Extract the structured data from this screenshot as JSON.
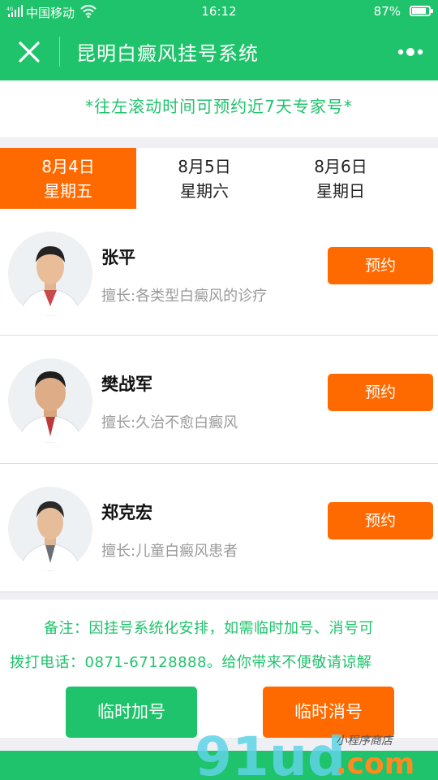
{
  "status_bar": {
    "carrier": "中国移动",
    "time": "16:12",
    "battery": "87%",
    "battery_level": 0.87
  },
  "nav": {
    "title": "昆明白癜风挂号系统",
    "close_icon": "close-icon",
    "more_icon": "more-dots-icon"
  },
  "notice": "*往左滚动时间可预约近7天专家号*",
  "dates": [
    {
      "date": "8月4日",
      "weekday": "星期五",
      "active": true
    },
    {
      "date": "8月5日",
      "weekday": "星期六",
      "active": false
    },
    {
      "date": "8月6日",
      "weekday": "星期日",
      "active": false
    }
  ],
  "doctors": [
    {
      "name": "张平",
      "specialty": "擅长:各类型白癜风的诊疗",
      "button": "预约"
    },
    {
      "name": "樊战军",
      "specialty": "擅长:久治不愈白癜风",
      "button": "预约"
    },
    {
      "name": "郑克宏",
      "specialty": "擅长:儿童白癜风患者",
      "button": "预约"
    }
  ],
  "remark": {
    "line1": "备注：因挂号系统化安排，如需临时加号、消号可",
    "line2": "拨打电话：0871-67128888。给你带来不便敬请谅解"
  },
  "actions": {
    "add": "临时加号",
    "cancel": "临时消号"
  },
  "watermark": {
    "brand": "91ud",
    "domain": ".com",
    "tagline": "小程序商店"
  },
  "colors": {
    "brand_green": "#1fc36b",
    "accent_orange": "#ff6a00"
  }
}
